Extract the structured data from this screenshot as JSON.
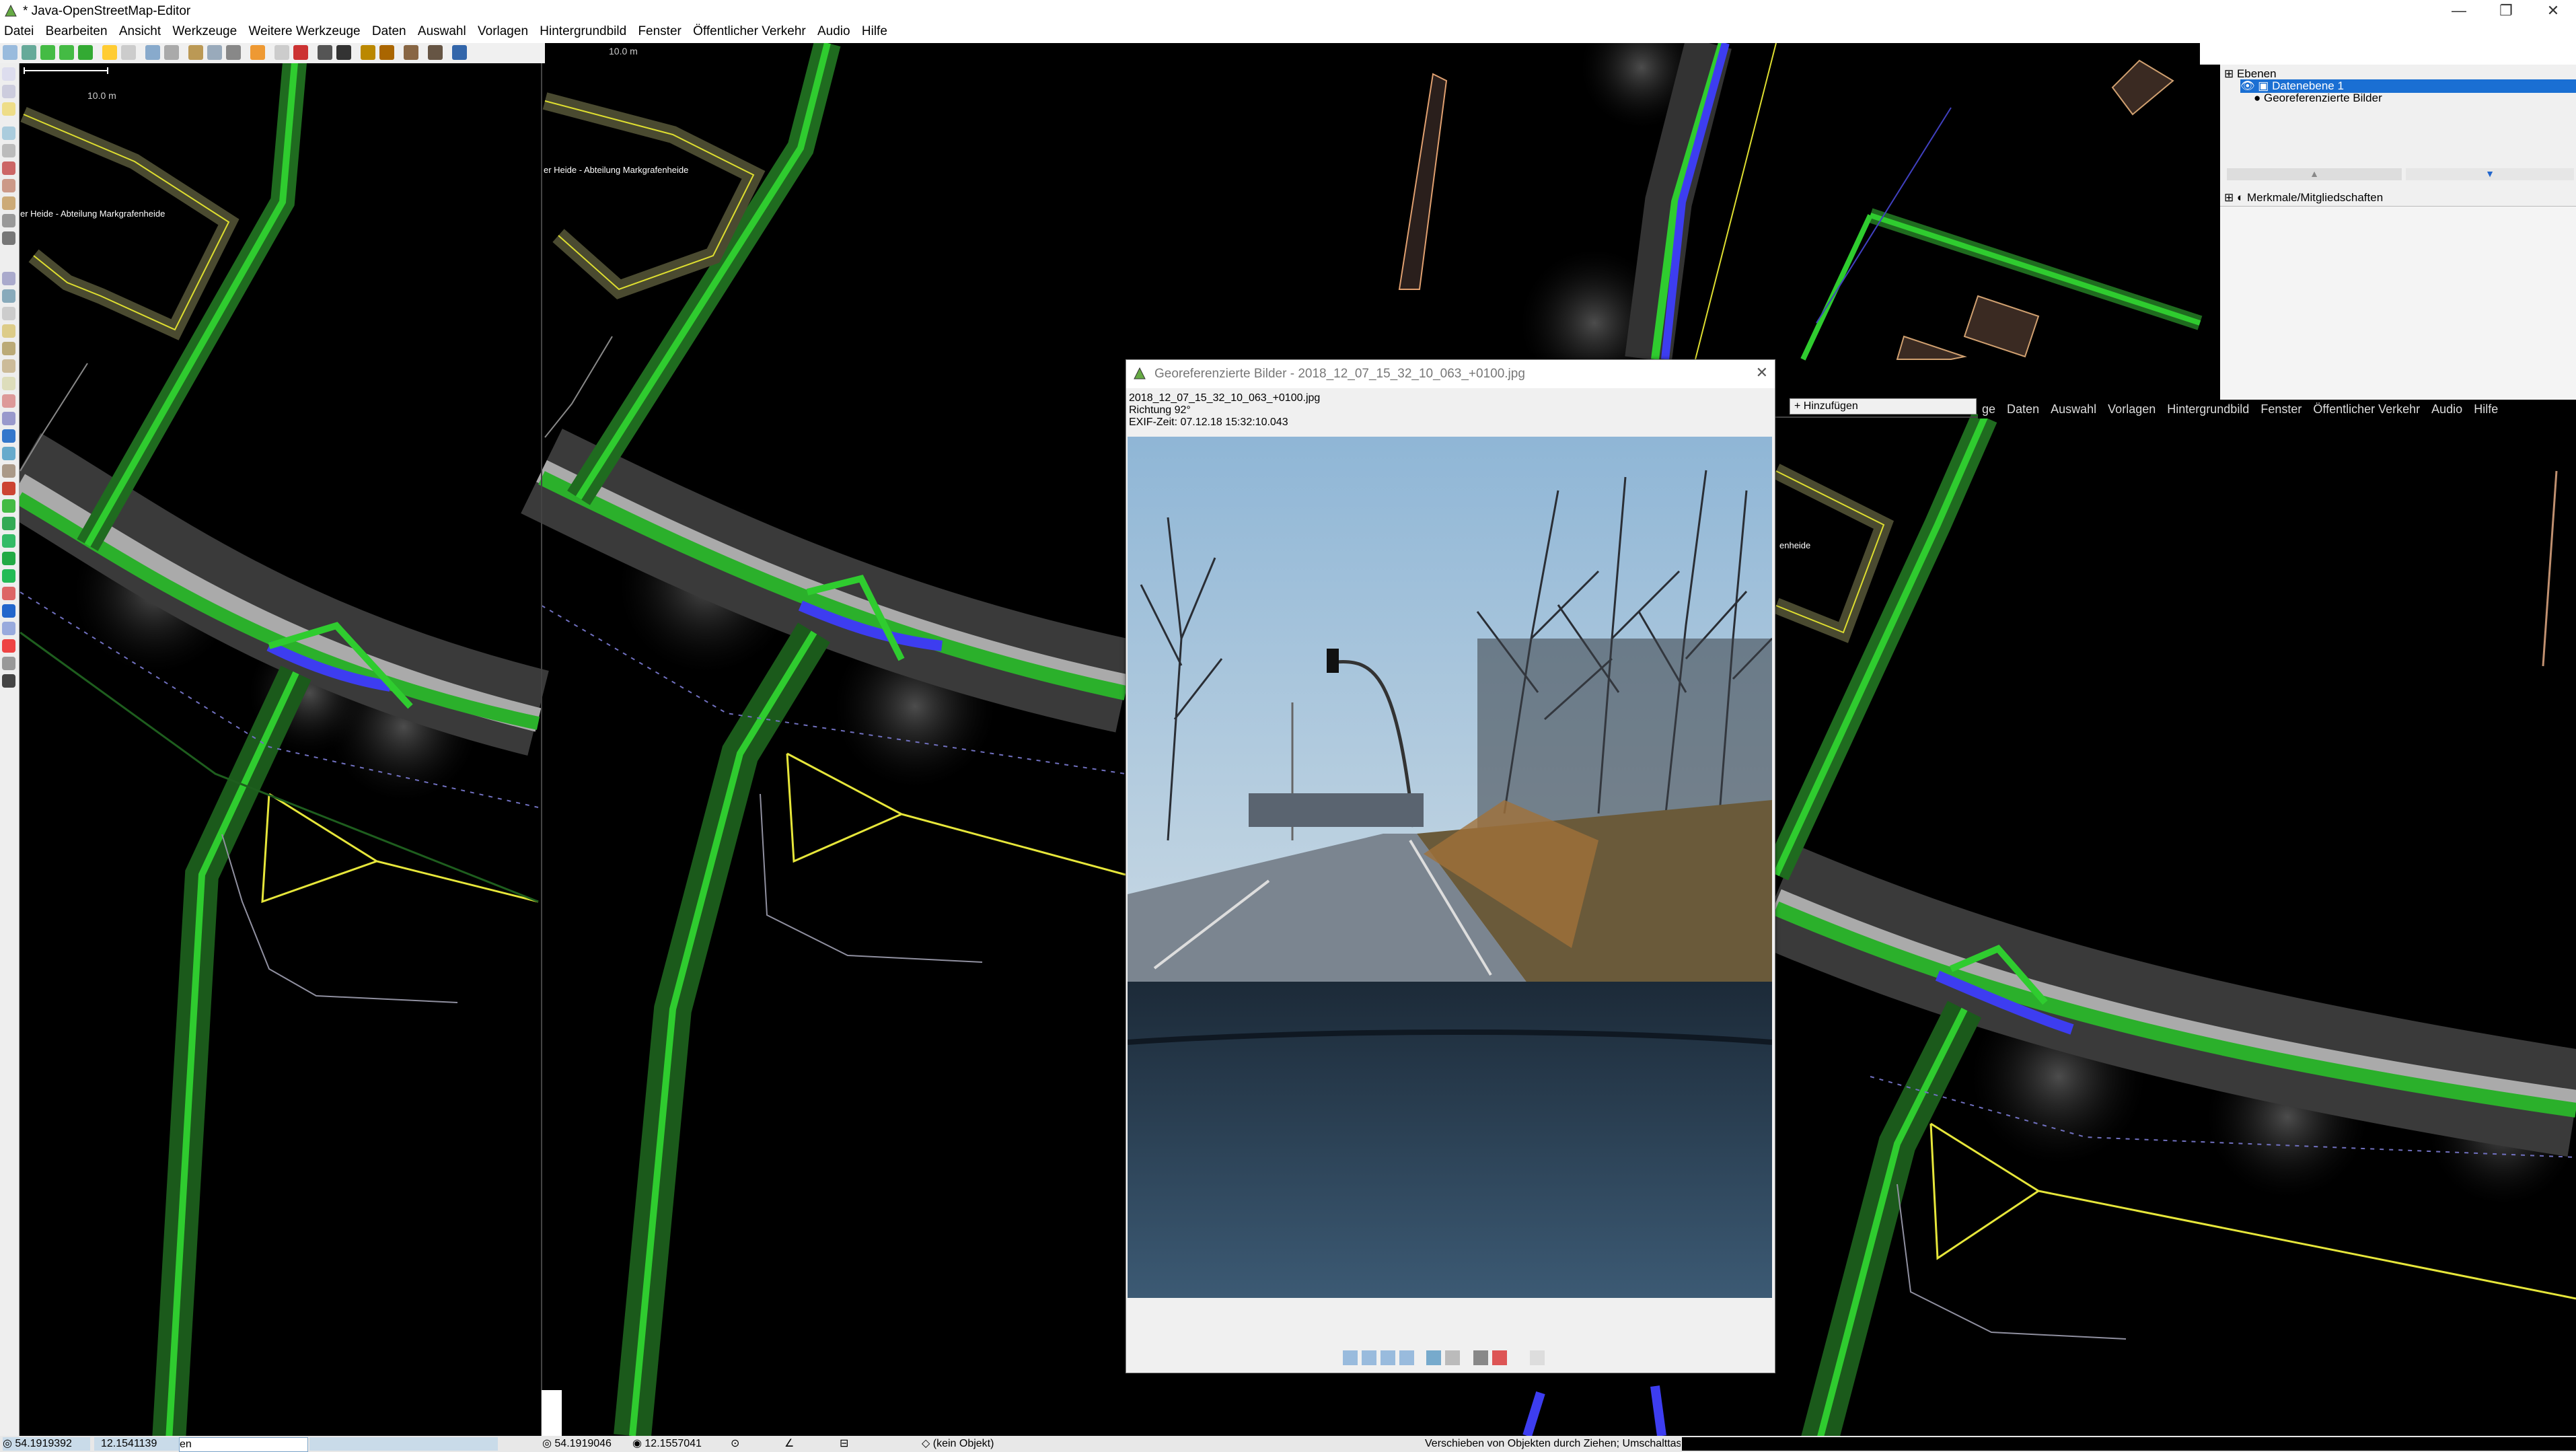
{
  "window": {
    "title": "* Java-OpenStreetMap-Editor",
    "minimize_label": "—",
    "restore_label": "❐",
    "close_label": "✕"
  },
  "menu": [
    "Datei",
    "Bearbeiten",
    "Ansicht",
    "Werkzeuge",
    "Weitere Werkzeuge",
    "Daten",
    "Auswahl",
    "Vorlagen",
    "Hintergrundbild",
    "Fenster",
    "Öffentlicher Verkehr",
    "Audio",
    "Hilfe"
  ],
  "menu_overlay": [
    "ge",
    "Daten",
    "Auswahl",
    "Vorlagen",
    "Hintergrundbild",
    "Fenster",
    "Öffentlicher Verkehr",
    "Audio",
    "Hilfe"
  ],
  "map": {
    "scale_label_left": "10.0 m",
    "scale_label_mid": "10.0 m",
    "place_label_left": "er Heide - Abteilung Markgrafenheide",
    "place_label_mid": "er Heide - Abteilung Markgrafenheide",
    "place_label_right": "enheide",
    "colors": {
      "road_green": "#22a822",
      "road_blue": "#3b3bf0",
      "yellow_way": "#e0e040",
      "building": "#3a2a22"
    }
  },
  "layers_panel": {
    "header": "Ebenen",
    "items": [
      {
        "label": "Datenebene 1",
        "selected": true
      },
      {
        "label": "Georeferenzierte Bilder",
        "selected": false
      }
    ],
    "properties_header": "Merkmale/Mitgliedschaften",
    "add_button": "Hinzufügen"
  },
  "image_dialog": {
    "title": "Georeferenzierte Bilder - 2018_12_07_15_32_10_063_+0100.jpg",
    "filename": "2018_12_07_15_32_10_063_+0100.jpg",
    "direction": "Richtung 92°",
    "exif_time": "EXIF-Zeit: 07.12.18 15:32:10.043"
  },
  "status": {
    "lat_left": "54.1919392",
    "lon_left": "12.1541139",
    "input_left": "en",
    "lat_mid": "54.1919046",
    "lon_mid": "12.1557041",
    "no_object": "(kein Objekt)",
    "hint": "Verschieben von Objekten durch Ziehen; Umschalttas"
  }
}
